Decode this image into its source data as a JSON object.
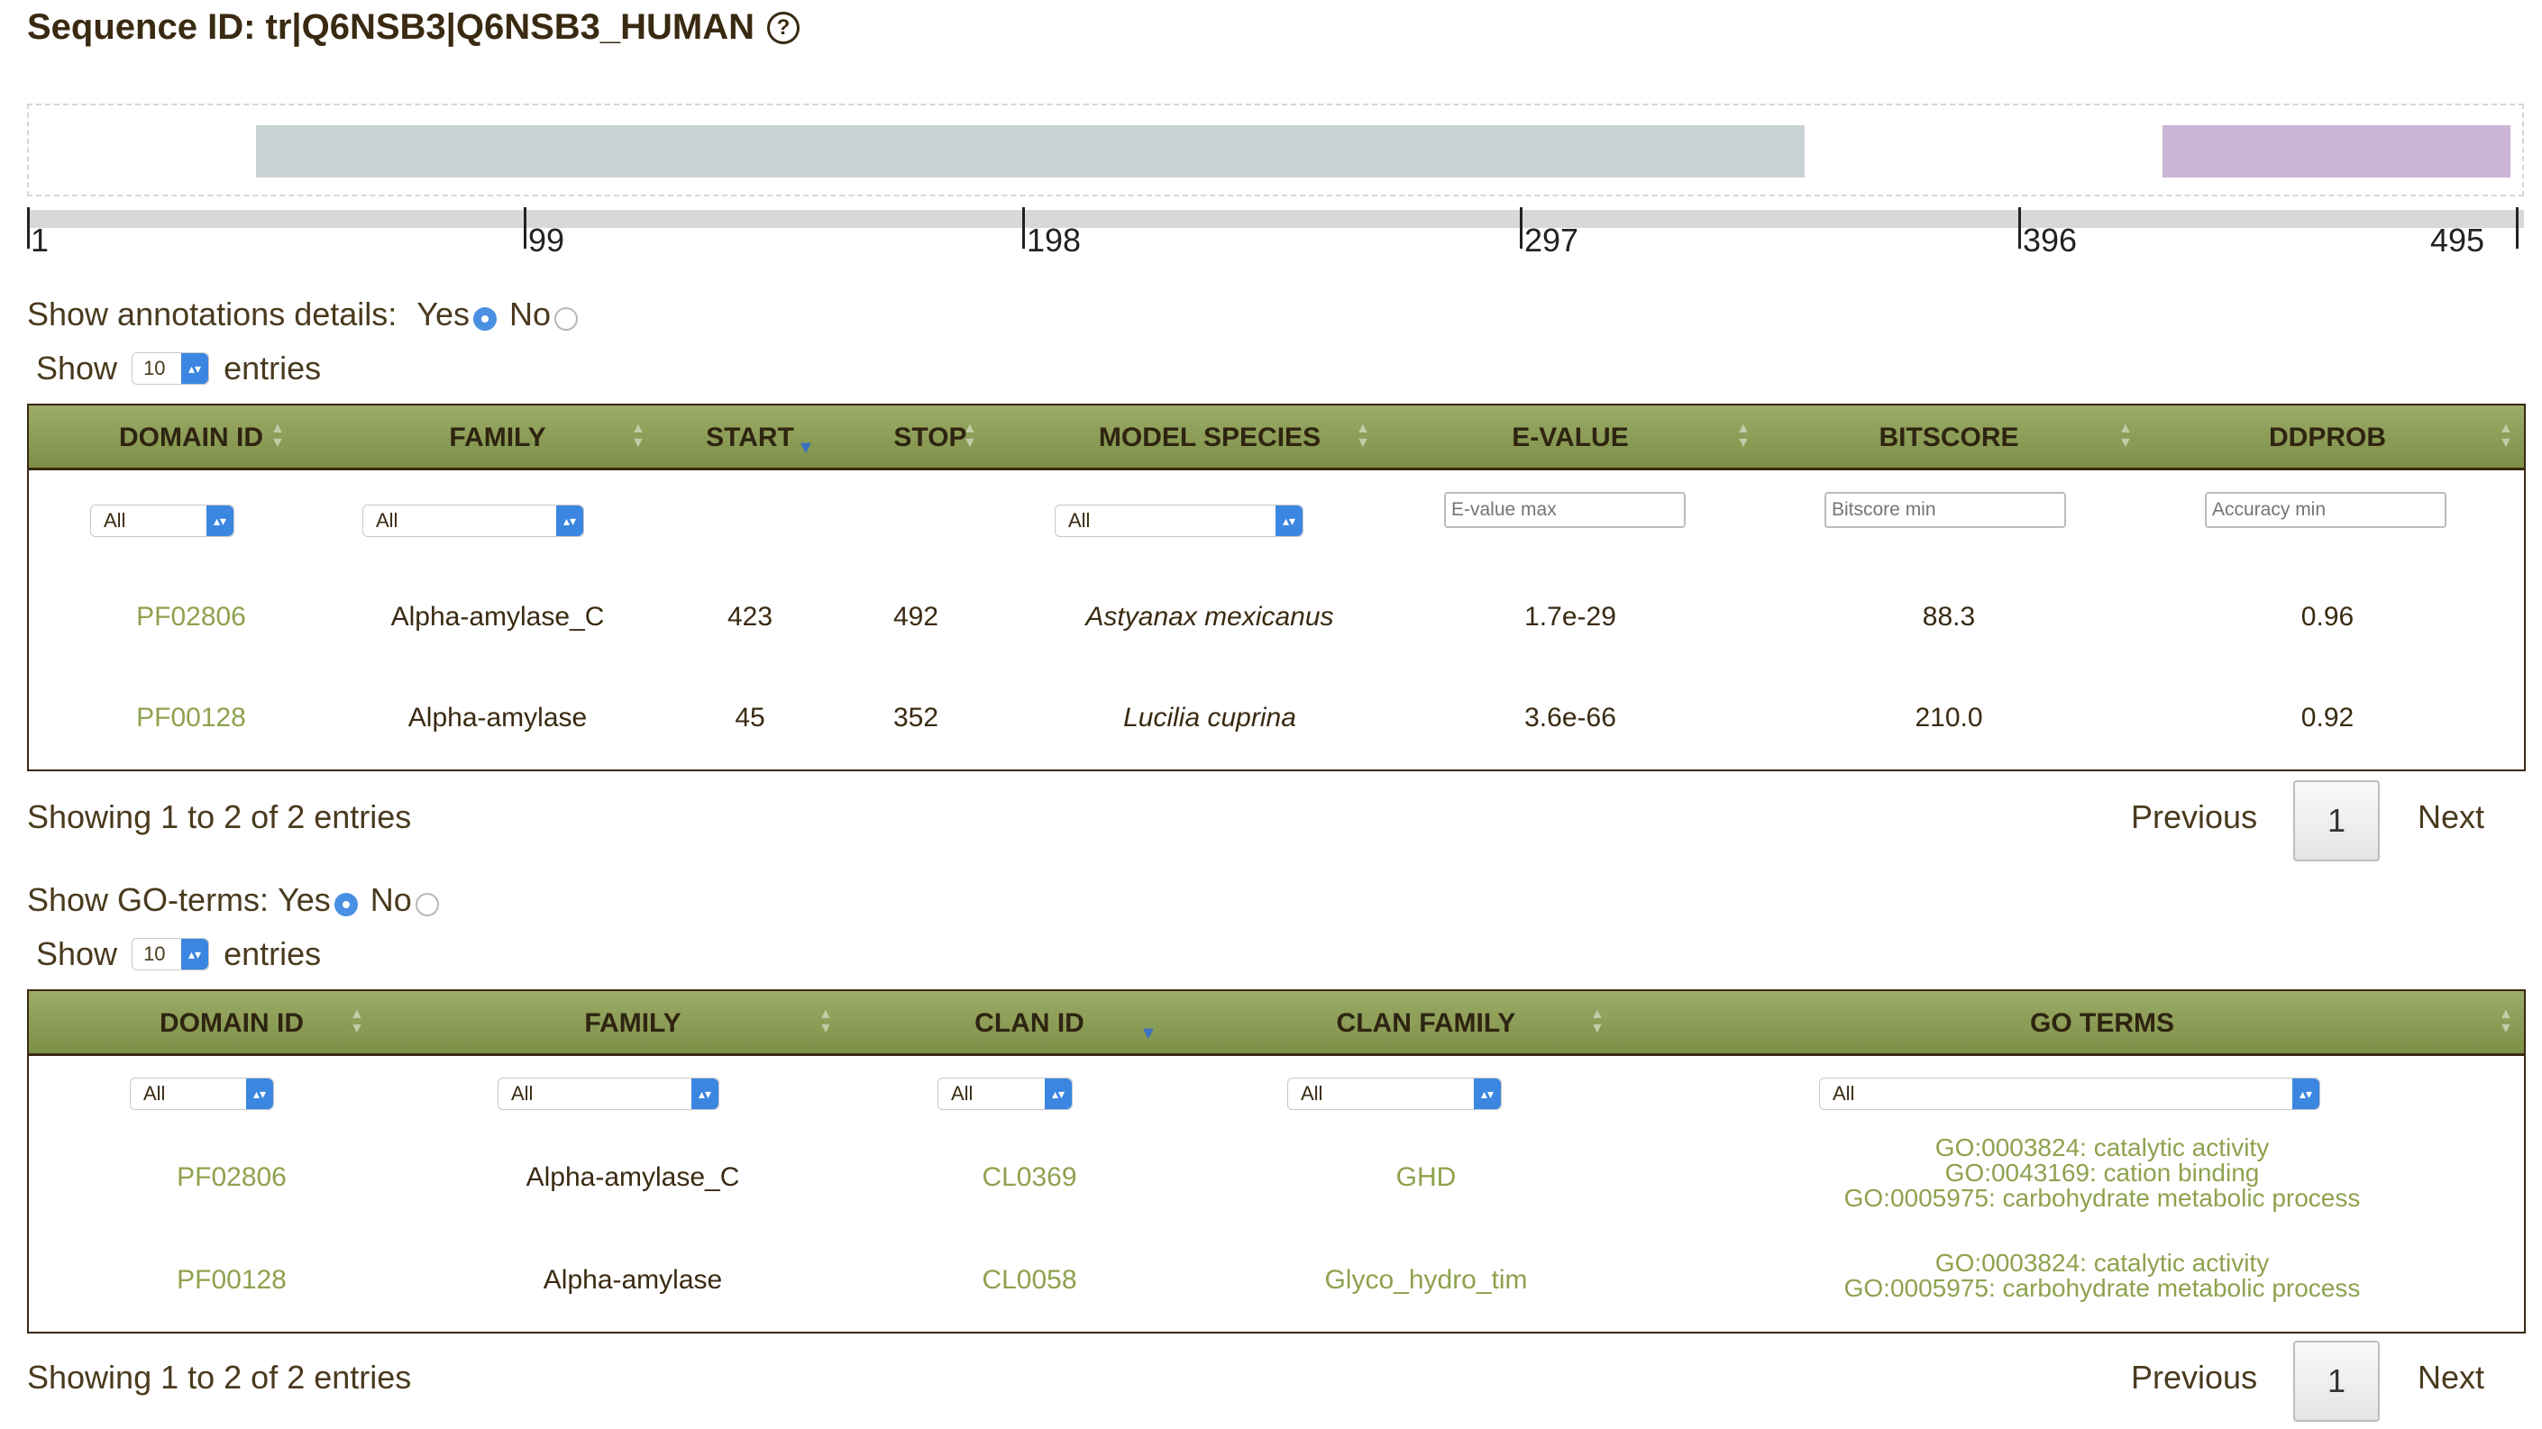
{
  "sequence": {
    "title": "Sequence ID: tr|Q6NSB3|Q6NSB3_HUMAN",
    "help_icon": "question-circle-icon"
  },
  "diagram": {
    "domains": [
      {
        "name": "PF00128",
        "start": 45,
        "stop": 352,
        "color": "#c9d3d6"
      },
      {
        "name": "PF02806",
        "start": 423,
        "stop": 492,
        "color": "#cbb5d5"
      }
    ],
    "ticks": [
      "1",
      "99",
      "198",
      "297",
      "396",
      "495"
    ]
  },
  "annotations": {
    "toggle_label": "Show annotations details:",
    "yes_label": "Yes",
    "no_label": "No",
    "selected": "Yes",
    "length": {
      "show_label": "Show",
      "value": "10",
      "entries_label": "entries"
    },
    "columns": [
      "DOMAIN ID",
      "FAMILY",
      "START",
      "STOP",
      "MODEL SPECIES",
      "E-VALUE",
      "BITSCORE",
      "DDPROB"
    ],
    "filters": {
      "domain_id": "All",
      "family": "All",
      "model_species": "All",
      "evalue_placeholder": "E-value max",
      "bitscore_placeholder": "Bitscore min",
      "accuracy_placeholder": "Accuracy min"
    },
    "rows": [
      {
        "domain_id": "PF02806",
        "family": "Alpha-amylase_C",
        "start": "423",
        "stop": "492",
        "species": "Astyanax mexicanus",
        "evalue": "1.7e-29",
        "bitscore": "88.3",
        "ddprob": "0.96"
      },
      {
        "domain_id": "PF00128",
        "family": "Alpha-amylase",
        "start": "45",
        "stop": "352",
        "species": "Lucilia cuprina",
        "evalue": "3.6e-66",
        "bitscore": "210.0",
        "ddprob": "0.92"
      }
    ],
    "info": "Showing 1 to 2 of 2 entries",
    "pager": {
      "previous": "Previous",
      "page": "1",
      "next": "Next"
    }
  },
  "go": {
    "toggle_label": "Show GO-terms:",
    "yes_label": "Yes",
    "no_label": "No",
    "selected": "Yes",
    "length": {
      "show_label": "Show",
      "value": "10",
      "entries_label": "entries"
    },
    "columns": [
      "DOMAIN ID",
      "FAMILY",
      "CLAN ID",
      "CLAN FAMILY",
      "GO TERMS"
    ],
    "filters": {
      "domain_id": "All",
      "family": "All",
      "clan_id": "All",
      "clan_family": "All",
      "go_terms": "All"
    },
    "rows": [
      {
        "domain_id": "PF02806",
        "family": "Alpha-amylase_C",
        "clan_id": "CL0369",
        "clan_family": "GHD",
        "go_terms": [
          "GO:0003824: catalytic activity",
          "GO:0043169: cation binding",
          "GO:0005975: carbohydrate metabolic process"
        ]
      },
      {
        "domain_id": "PF00128",
        "family": "Alpha-amylase",
        "clan_id": "CL0058",
        "clan_family": "Glyco_hydro_tim",
        "go_terms": [
          "GO:0003824: catalytic activity",
          "GO:0005975: carbohydrate metabolic process"
        ]
      }
    ],
    "info": "Showing 1 to 2 of 2 entries",
    "pager": {
      "previous": "Previous",
      "page": "1",
      "next": "Next"
    }
  }
}
